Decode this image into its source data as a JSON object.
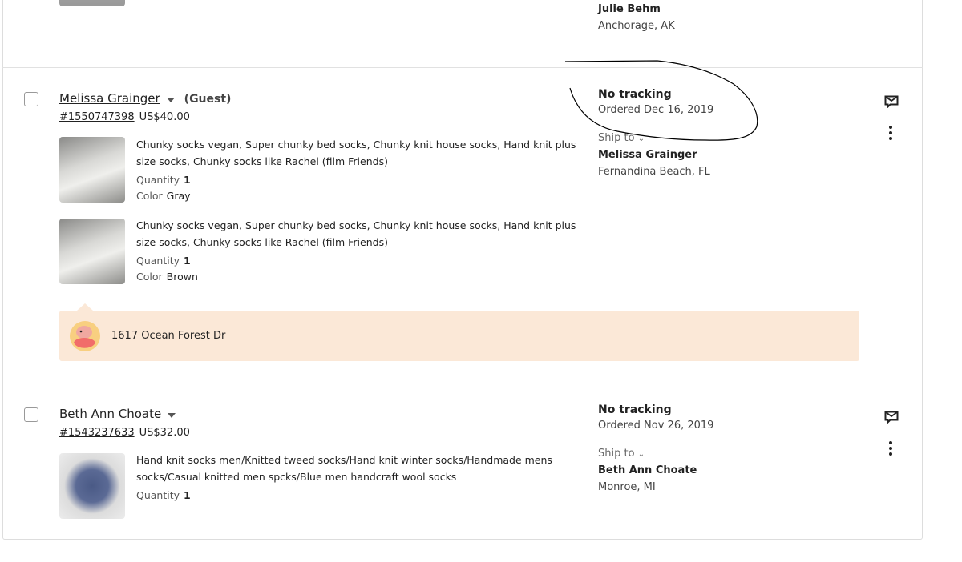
{
  "previous_order": {
    "ship_name": "Julie Behm",
    "ship_city": "Anchorage, AK"
  },
  "orders": [
    {
      "buyer": "Melissa Grainger",
      "guest_label": "(Guest)",
      "order_number": "#1550747398",
      "total": "US$40.00",
      "tracking": "No tracking",
      "ordered": "Ordered Dec 16, 2019",
      "ship_to_label": "Ship to",
      "ship_name": "Melissa Grainger",
      "ship_city": "Fernandina Beach, FL",
      "items": [
        {
          "title": "Chunky socks vegan, Super chunky bed socks, Chunky knit house socks, Hand knit plus size socks, Chunky socks like Rachel (film Friends)",
          "quantity_label": "Quantity",
          "quantity": "1",
          "color_label": "Color",
          "color": "Gray"
        },
        {
          "title": "Chunky socks vegan, Super chunky bed socks, Chunky knit house socks, Hand knit plus size socks, Chunky socks like Rachel (film Friends)",
          "quantity_label": "Quantity",
          "quantity": "1",
          "color_label": "Color",
          "color": "Brown"
        }
      ],
      "note": "1617 Ocean Forest Dr"
    },
    {
      "buyer": "Beth Ann Choate",
      "order_number": "#1543237633",
      "total": "US$32.00",
      "tracking": "No tracking",
      "ordered": "Ordered Nov 26, 2019",
      "ship_to_label": "Ship to",
      "ship_name": "Beth Ann Choate",
      "ship_city": "Monroe, MI",
      "items": [
        {
          "title": "Hand knit socks men/Knitted tweed socks/Hand knit winter socks/Handmade mens socks/Casual knitted men spcks/Blue men handcraft wool socks",
          "quantity_label": "Quantity",
          "quantity": "1"
        }
      ]
    }
  ],
  "colors": {
    "note_bg": "#fbe8d7",
    "annotation": "#000000"
  },
  "icons": [
    "message-icon",
    "more-vertical-icon",
    "caret-down-icon",
    "chevron-down-icon",
    "avatar-icon"
  ]
}
